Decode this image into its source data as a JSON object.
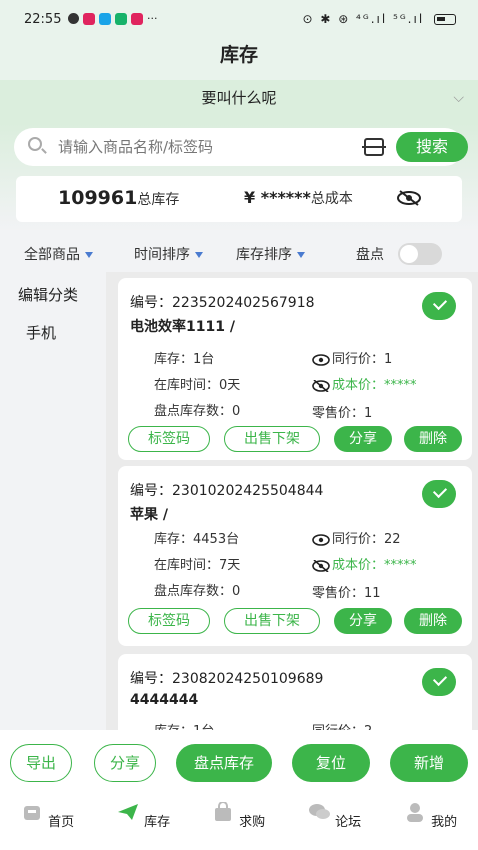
{
  "status_bar": {
    "time": "22:55",
    "right": "⊙ ✱ ⊛ ⁴ᴳ.ıl ⁵ᴳ.ıl"
  },
  "header": {
    "title": "库存"
  },
  "shop": {
    "name": "要叫什么呢",
    "chevron": "⌵"
  },
  "search": {
    "placeholder": "请输入商品名称/标签码",
    "button": "搜索"
  },
  "summary": {
    "total_value": "109961",
    "total_label": "总库存",
    "cost_value": "¥ ******",
    "cost_label": "总成本"
  },
  "filters": {
    "all": "全部商品",
    "time_sort": "时间排序",
    "stock_sort": "库存排序",
    "count": "盘点",
    "count_enabled": false
  },
  "sidebar": {
    "edit": "编辑分类",
    "items": [
      "手机"
    ]
  },
  "products": [
    {
      "code": "编号：2235202402567918",
      "name": "电池效率1111 /",
      "stock": "库存：1台",
      "peer_price": "同行价：1",
      "days": "在库时间：0天",
      "cost": "成本价：*****",
      "count_stock": "盘点库存数：0",
      "retail": "零售价：1",
      "btn_tag": "标签码",
      "btn_offshelf": "出售下架",
      "btn_share": "分享",
      "btn_delete": "删除"
    },
    {
      "code": "编号：23010202425504844",
      "name": "苹果 /",
      "stock": "库存：4453台",
      "peer_price": "同行价：22",
      "days": "在库时间：7天",
      "cost": "成本价：*****",
      "count_stock": "盘点库存数：0",
      "retail": "零售价：11",
      "btn_tag": "标签码",
      "btn_offshelf": "出售下架",
      "btn_share": "分享",
      "btn_delete": "删除"
    },
    {
      "code": "编号：23082024250109689",
      "name": "4444444",
      "stock": "库存：1台",
      "peer_price": "同行价：2"
    }
  ],
  "actions": {
    "export": "导出",
    "share": "分享",
    "count_stock": "盘点库存",
    "reset": "复位",
    "add": "新增"
  },
  "tabs": [
    "首页",
    "库存",
    "求购",
    "论坛",
    "我的"
  ],
  "colors": {
    "accent": "#3cb54a",
    "header_bg": "#e9f3ec"
  }
}
